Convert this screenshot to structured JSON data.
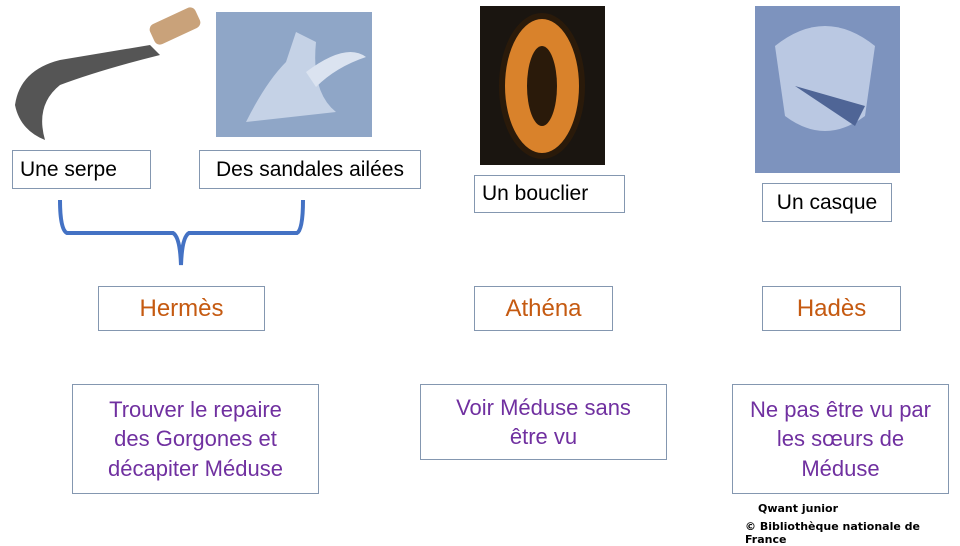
{
  "objects": [
    "Une serpe",
    "Des sandales ailées",
    "Un bouclier",
    "Un casque"
  ],
  "gods": [
    "Hermès",
    "Athéna",
    "Hadès"
  ],
  "tasks": [
    "Trouver le repaire des Gorgones et décapiter Méduse",
    "Voir Méduse sans être vu",
    "Ne pas être vu par les sœurs de Méduse"
  ],
  "credits": {
    "line1": "Qwant junior",
    "line2": "© Bibliothèque nationale de France"
  },
  "colors": {
    "god_text": "#c55a11",
    "task_text": "#7030a0",
    "brace": "#4472c4",
    "border": "#8497b0"
  }
}
